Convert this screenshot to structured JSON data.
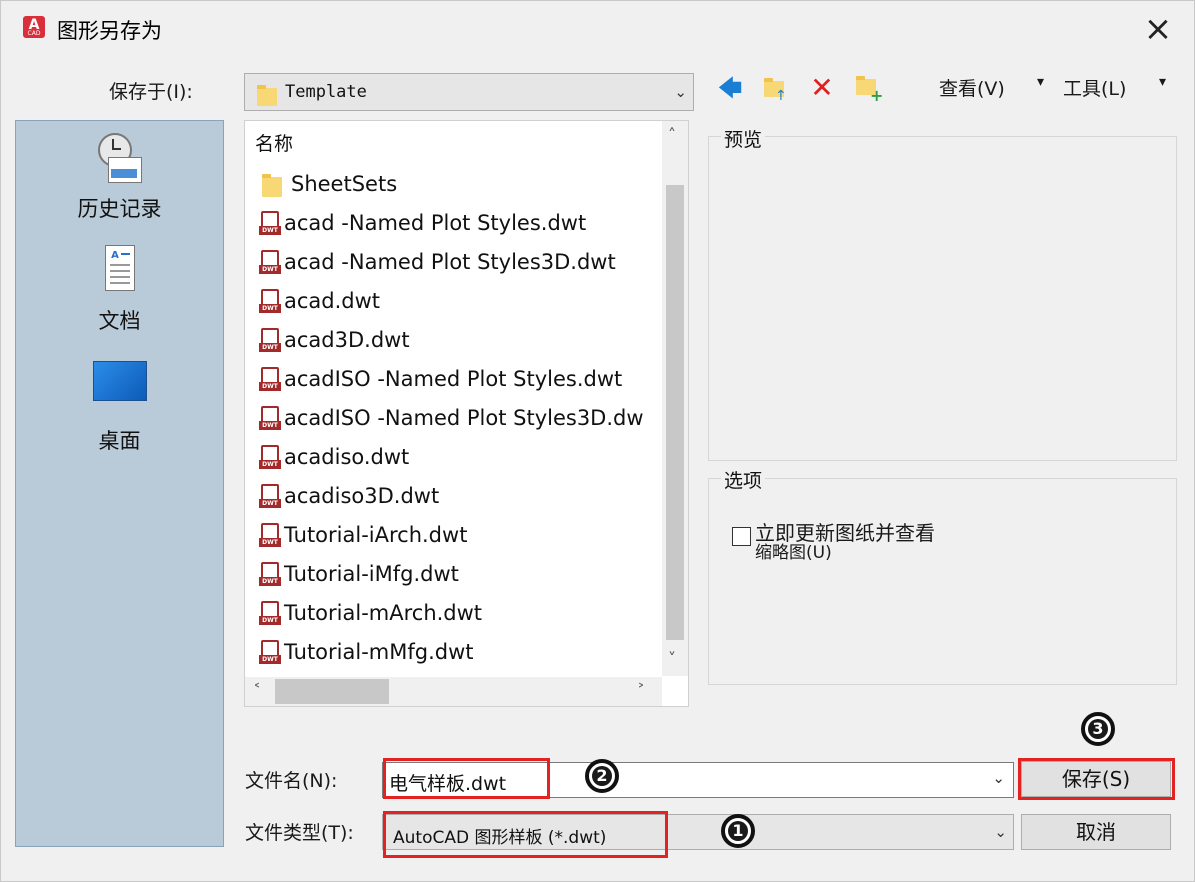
{
  "titlebar": {
    "title": "图形另存为",
    "app_icon_letter": "A",
    "app_icon_sub": "CAD"
  },
  "save_in": {
    "label": "保存于(I):",
    "value": "Template"
  },
  "toolbar": {
    "view_label": "查看(V)",
    "tools_label": "工具(L)"
  },
  "places": [
    {
      "name": "history",
      "label": "历史记录"
    },
    {
      "name": "documents",
      "label": "文档"
    },
    {
      "name": "desktop",
      "label": "桌面"
    }
  ],
  "file_list": {
    "column_header": "名称",
    "items": [
      {
        "name": "SheetSets",
        "type": "folder"
      },
      {
        "name": "acad -Named Plot Styles.dwt",
        "type": "dwt"
      },
      {
        "name": "acad -Named Plot Styles3D.dwt",
        "type": "dwt"
      },
      {
        "name": "acad.dwt",
        "type": "dwt"
      },
      {
        "name": "acad3D.dwt",
        "type": "dwt"
      },
      {
        "name": "acadISO -Named Plot Styles.dwt",
        "type": "dwt"
      },
      {
        "name": "acadISO -Named Plot Styles3D.dw",
        "type": "dwt"
      },
      {
        "name": "acadiso.dwt",
        "type": "dwt"
      },
      {
        "name": "acadiso3D.dwt",
        "type": "dwt"
      },
      {
        "name": "Tutorial-iArch.dwt",
        "type": "dwt"
      },
      {
        "name": "Tutorial-iMfg.dwt",
        "type": "dwt"
      },
      {
        "name": "Tutorial-mArch.dwt",
        "type": "dwt"
      },
      {
        "name": "Tutorial-mMfg.dwt",
        "type": "dwt"
      }
    ],
    "dwt_tag": "DWT"
  },
  "preview": {
    "title": "预览"
  },
  "options": {
    "title": "选项",
    "checkbox_line1": "立即更新图纸并查看",
    "checkbox_line2": "缩略图(U)"
  },
  "filename": {
    "label": "文件名(N):",
    "value": "电气样板.dwt"
  },
  "filetype": {
    "label": "文件类型(T):",
    "value": "AutoCAD 图形样板 (*.dwt)"
  },
  "buttons": {
    "save": "保存(S)",
    "cancel": "取消"
  },
  "callouts": [
    "1",
    "2",
    "3"
  ],
  "colors": {
    "highlight_red": "#e52222",
    "places_bg": "#b9cad8",
    "dwt_icon": "#a22a2a"
  }
}
